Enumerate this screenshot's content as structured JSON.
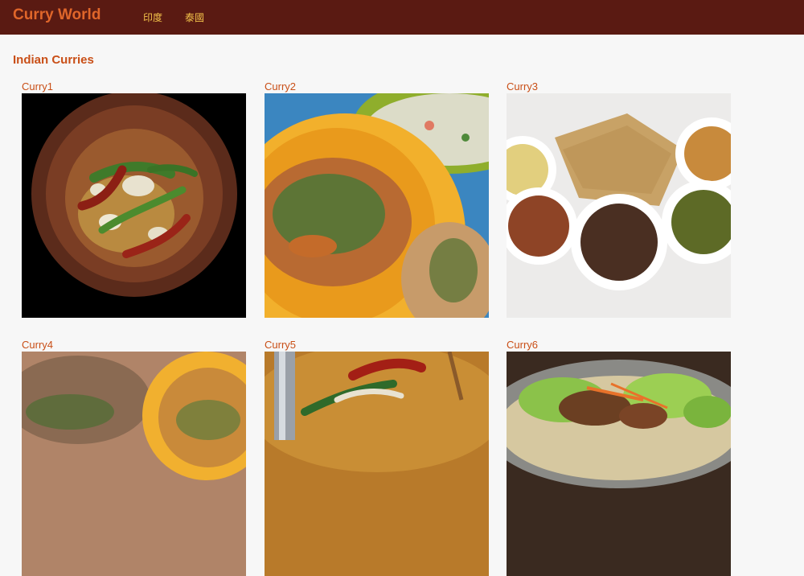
{
  "nav": {
    "brand": "Curry World",
    "links": [
      {
        "label": "印度"
      },
      {
        "label": "泰國"
      }
    ]
  },
  "section": {
    "title": "Indian Curries"
  },
  "cards": [
    {
      "title": "Curry1"
    },
    {
      "title": "Curry2"
    },
    {
      "title": "Curry3"
    },
    {
      "title": "Curry4"
    },
    {
      "title": "Curry5"
    },
    {
      "title": "Curry6"
    }
  ],
  "colors": {
    "navbar": "#5a1a12",
    "brand": "#e0662a",
    "nav_link": "#f2c24a",
    "heading": "#c94f17",
    "background": "#f7f7f7"
  }
}
